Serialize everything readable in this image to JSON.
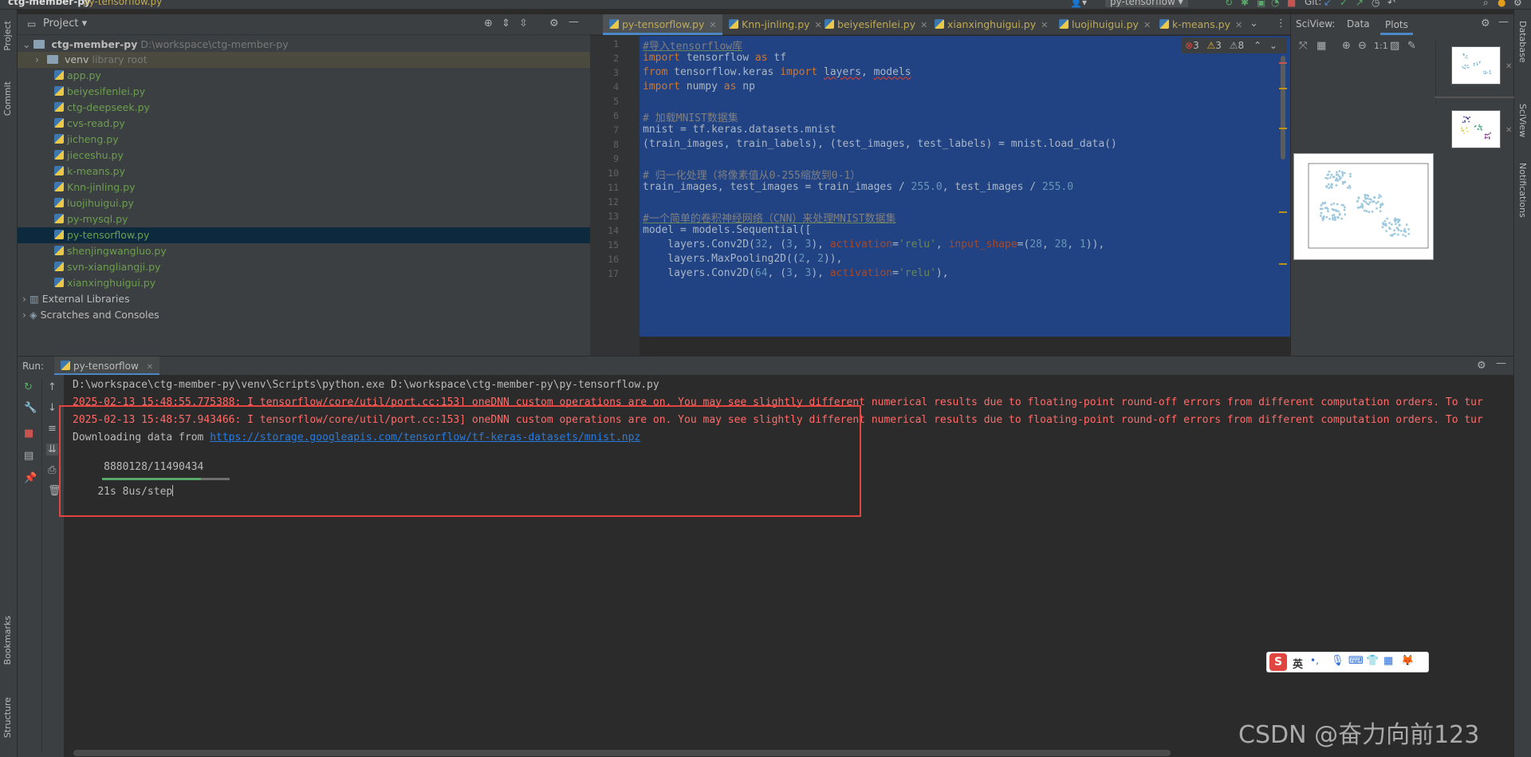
{
  "titlebar": {
    "project": "ctg-member-py",
    "file": "py-tensorflow.py",
    "run_config": "py-tensorflow",
    "vcs": "Git:"
  },
  "left_stripe": {
    "project": "Project",
    "commit": "Commit",
    "bookmarks": "Bookmarks",
    "structure": "Structure"
  },
  "right_stripe": {
    "database": "Database",
    "sciview": "SciView",
    "notifications": "Notifications"
  },
  "project_panel": {
    "title": "Project",
    "root": {
      "name": "ctg-member-py",
      "path": "D:\\workspace\\ctg-member-py"
    },
    "venv": {
      "name": "venv",
      "hint": "library root"
    },
    "files": [
      "app.py",
      "beiyesifenlei.py",
      "ctg-deepseek.py",
      "cvs-read.py",
      "jicheng.py",
      "jieceshu.py",
      "k-means.py",
      "Knn-jinling.py",
      "luojihuigui.py",
      "py-mysql.py",
      "py-tensorflow.py",
      "shenjingwangluo.py",
      "svn-xiangliangji.py",
      "xianxinghuigui.py"
    ],
    "selected": "py-tensorflow.py",
    "external": "External Libraries",
    "scratches": "Scratches and Consoles"
  },
  "editor": {
    "tabs": [
      "py-tensorflow.py",
      "Knn-jinling.py",
      "beiyesifenlei.py",
      "xianxinghuigui.py",
      "luojihuigui.py",
      "k-means.py"
    ],
    "active_tab": "py-tensorflow.py",
    "inspections": {
      "errors": "3",
      "warnings": "3",
      "weak": "8"
    },
    "line_numbers": [
      "1",
      "2",
      "3",
      "4",
      "5",
      "6",
      "7",
      "8",
      "9",
      "10",
      "11",
      "12",
      "13",
      "14",
      "15",
      "16",
      "17"
    ]
  },
  "sciview": {
    "title": "SciView:",
    "tab_data": "Data",
    "tab_plots": "Plots",
    "zoom_label": "1:1"
  },
  "run": {
    "label": "Run:",
    "tab": "py-tensorflow",
    "lines": {
      "cmd": "D:\\workspace\\ctg-member-py\\venv\\Scripts\\python.exe D:\\workspace\\ctg-member-py\\py-tensorflow.py",
      "warn1": "2025-02-13 15:48:55.775388: I tensorflow/core/util/port.cc:153] oneDNN custom operations are on. You may see slightly different numerical results due to floating-point round-off errors from different computation orders. To tur",
      "warn2": "2025-02-13 15:48:57.943466: I tensorflow/core/util/port.cc:153] oneDNN custom operations are on. You may see slightly different numerical results due to floating-point round-off errors from different computation orders. To tur",
      "download_prefix": "Downloading data from ",
      "download_url": "https://storage.googleapis.com/tensorflow/tf-keras-datasets/mnist.npz",
      "progress_count": " 8880128/11490434",
      "progress_eta": "21s 8us/step"
    },
    "progress_fraction": 0.773
  },
  "ime": {
    "lang": "英",
    "punct": "•,"
  },
  "watermark": "CSDN @奋力向前123"
}
